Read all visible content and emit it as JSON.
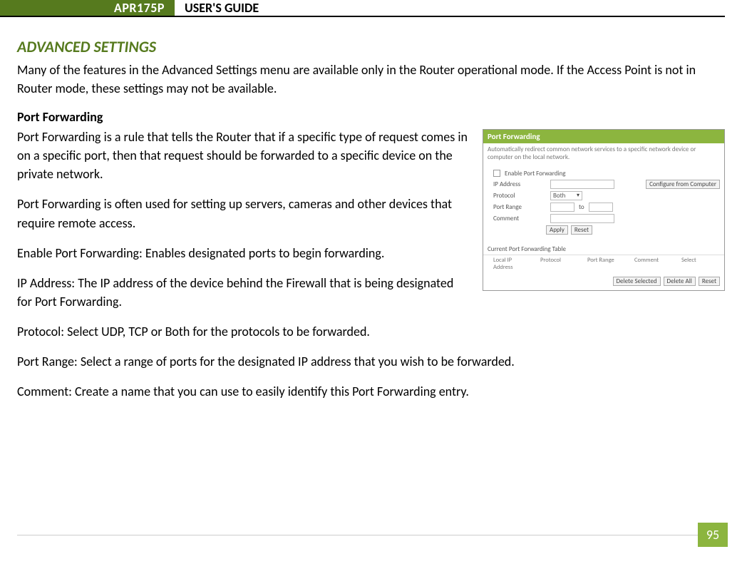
{
  "header": {
    "model": "APR175P",
    "title": "USER'S GUIDE"
  },
  "section": {
    "title": "ADVANCED SETTINGS",
    "intro": "Many of the features in the Advanced Settings menu are available only in the Router operational mode.  If the Access Point is not in Router mode, these settings may not be available.",
    "subtitle": "Port Forwarding",
    "p1": "Port Forwarding is a rule that tells the Router that if a specific type of request comes in on a specific port, then that request should be forwarded to a specific device on the private network.",
    "p2": "Port Forwarding is often used for setting up servers, cameras and other devices that require remote access.",
    "p3": "Enable Port Forwarding: Enables designated ports to begin forwarding.",
    "p4": "IP Address:  The IP address of the device behind the Firewall that is being designated for Port Forwarding.",
    "p5": "Protocol: Select UDP, TCP or Both for the protocols to be forwarded.",
    "p6": "Port Range: Select a range of ports for the designated IP address that you wish to be forwarded.",
    "p7": "Comment: Create a name that you can use to easily identify this Port Forwarding entry."
  },
  "screenshot": {
    "title": "Port Forwarding",
    "desc": "Automatically redirect common network services to a specific network device or computer on the local network.",
    "fields": {
      "enable": "Enable Port Forwarding",
      "ip": "IP Address",
      "protocol": "Protocol",
      "protocol_value": "Both",
      "portrange": "Port Range",
      "portrange_sep": "to",
      "comment": "Comment",
      "configure": "Configure from Computer",
      "apply": "Apply",
      "reset": "Reset"
    },
    "table": {
      "caption": "Current Port Forwarding Table",
      "headers": [
        "Local IP Address",
        "Protocol",
        "Port Range",
        "Comment",
        "Select"
      ],
      "actions": {
        "delsel": "Delete Selected",
        "delall": "Delete All",
        "reset": "Reset"
      }
    }
  },
  "page_number": "95"
}
